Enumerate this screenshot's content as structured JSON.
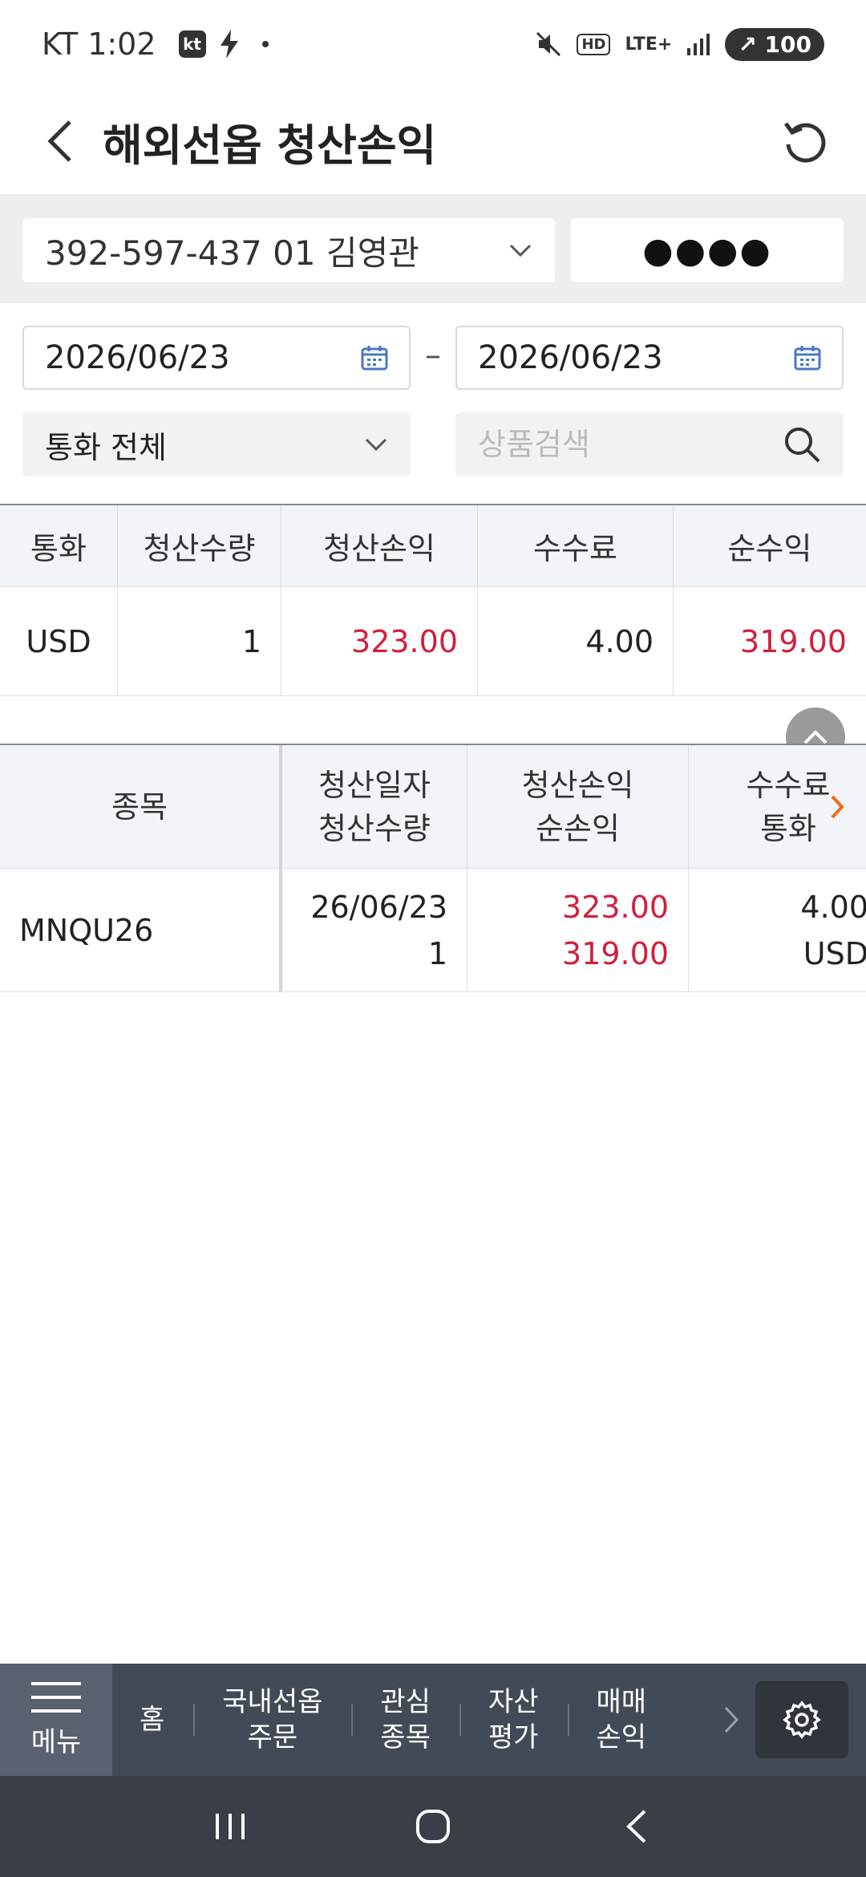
{
  "status_bar": {
    "carrier": "KT",
    "time": "1:02",
    "kt_badge": "kt",
    "hd": "HD",
    "network": "LTE+",
    "battery": "100"
  },
  "header": {
    "title": "해외선옵 청산손익"
  },
  "account": {
    "number": "392-597-437 01 김영관",
    "password_mask": "●●●●"
  },
  "filters": {
    "date_from": "2026/06/23",
    "date_separator": "–",
    "date_to": "2026/06/23",
    "currency": "통화 전체",
    "search_placeholder": "상품검색",
    "search_value": ""
  },
  "summary": {
    "headers": [
      "통화",
      "청산수량",
      "청산손익",
      "수수료",
      "순수익"
    ],
    "row": {
      "currency": "USD",
      "quantity": "1",
      "pnl": "323.00",
      "fee": "4.00",
      "net": "319.00"
    }
  },
  "detail": {
    "headers": {
      "symbol": "종목",
      "date": "청산일자",
      "quantity": "청산수량",
      "pnl": "청산손익",
      "net": "순손익",
      "fee": "수수료",
      "currency": "통화"
    },
    "rows": [
      {
        "symbol": "MNQU26",
        "date": "26/06/23",
        "quantity": "1",
        "pnl": "323.00",
        "net": "319.00",
        "fee": "4.00",
        "currency": "USD"
      }
    ]
  },
  "bottom_nav": {
    "menu_label": "메뉴",
    "items": [
      {
        "line1": "홈",
        "line2": ""
      },
      {
        "line1": "국내선옵",
        "line2": "주문"
      },
      {
        "line1": "관심",
        "line2": "종목"
      },
      {
        "line1": "자산",
        "line2": "평가"
      },
      {
        "line1": "매매",
        "line2": "손익"
      }
    ]
  },
  "colors": {
    "profit_red": "#d01f3c",
    "accent_orange": "#f26a1b",
    "nav_bg": "#434a57"
  }
}
